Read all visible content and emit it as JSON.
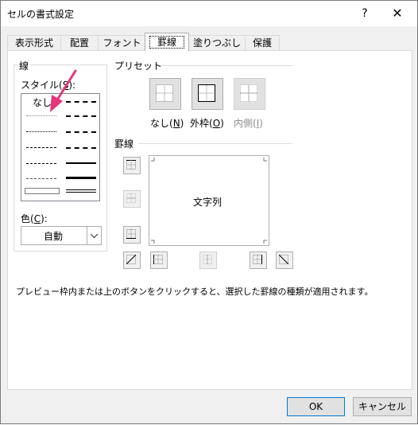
{
  "window": {
    "title": "セルの書式設定",
    "help": "?",
    "close": "✕"
  },
  "tabs": [
    {
      "label": "表示形式"
    },
    {
      "label": "配置"
    },
    {
      "label": "フォント"
    },
    {
      "label": "罫線"
    },
    {
      "label": "塗りつぶし"
    },
    {
      "label": "保護"
    }
  ],
  "line_group": {
    "title": "線",
    "style_label": "スタイル(",
    "style_key": "S",
    "style_label_end": "):",
    "none_label": "なし",
    "color_label": "色(",
    "color_key": "C",
    "color_label_end": "):",
    "color_value": "自動"
  },
  "preset_group": {
    "title": "プリセット",
    "none_label": "なし(",
    "none_key": "N",
    "outline_label": "外枠(",
    "outline_key": "O",
    "inside_label": "内側(",
    "inside_key": "I",
    "close_paren": ")"
  },
  "border_group": {
    "title": "罫線",
    "preview_text": "文字列"
  },
  "description": "プレビュー枠内または上のボタンをクリックすると、選択した罫線の種類が適用されます。",
  "buttons": {
    "ok": "OK",
    "cancel": "キャンセル"
  },
  "colors": {
    "annotation_arrow": "#e6357a",
    "selection_blue": "#0078d7"
  }
}
